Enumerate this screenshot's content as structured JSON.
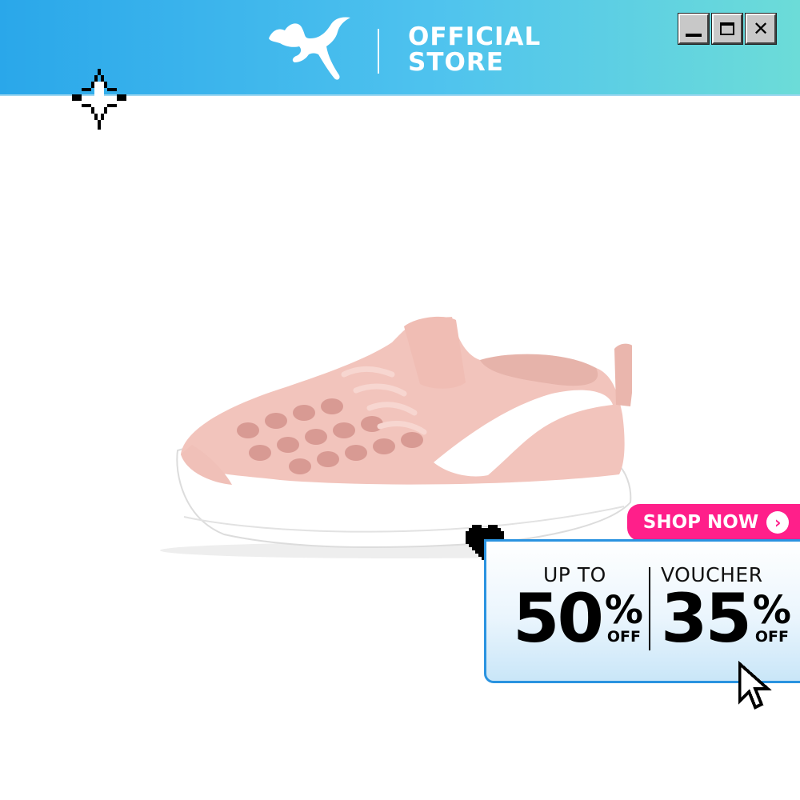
{
  "header": {
    "brand_logo": "puma-cat-logo",
    "title_line1": "OFFICIAL",
    "title_line2": "STORE",
    "window_buttons": {
      "minimize_icon": "minimize-icon",
      "maximize_icon": "maximize-icon",
      "close_label": "✕"
    },
    "colors": {
      "gradient_start": "#2aa7ea",
      "gradient_end": "#6cdcd8"
    }
  },
  "decorations": {
    "sparkle_icon": "pixel-sparkle-icon",
    "heart_icon": "pixel-heart-icon",
    "cursor_icon": "pixel-cursor-icon"
  },
  "product": {
    "image": "pink-kids-sneaker",
    "colors": {
      "upper": "#f2c4bc",
      "stripe": "#ffffff",
      "sole": "#ffffff"
    }
  },
  "promo": {
    "shop_now_label": "SHOP NOW",
    "shop_now_icon": "chevron-right-icon",
    "left": {
      "label": "UP TO",
      "value": "50",
      "percent": "%",
      "suffix": "OFF"
    },
    "right": {
      "label": "VOUCHER",
      "value": "35",
      "percent": "%",
      "suffix": "OFF"
    },
    "colors": {
      "accent": "#ff1f8a",
      "border": "#2a93e0"
    }
  }
}
